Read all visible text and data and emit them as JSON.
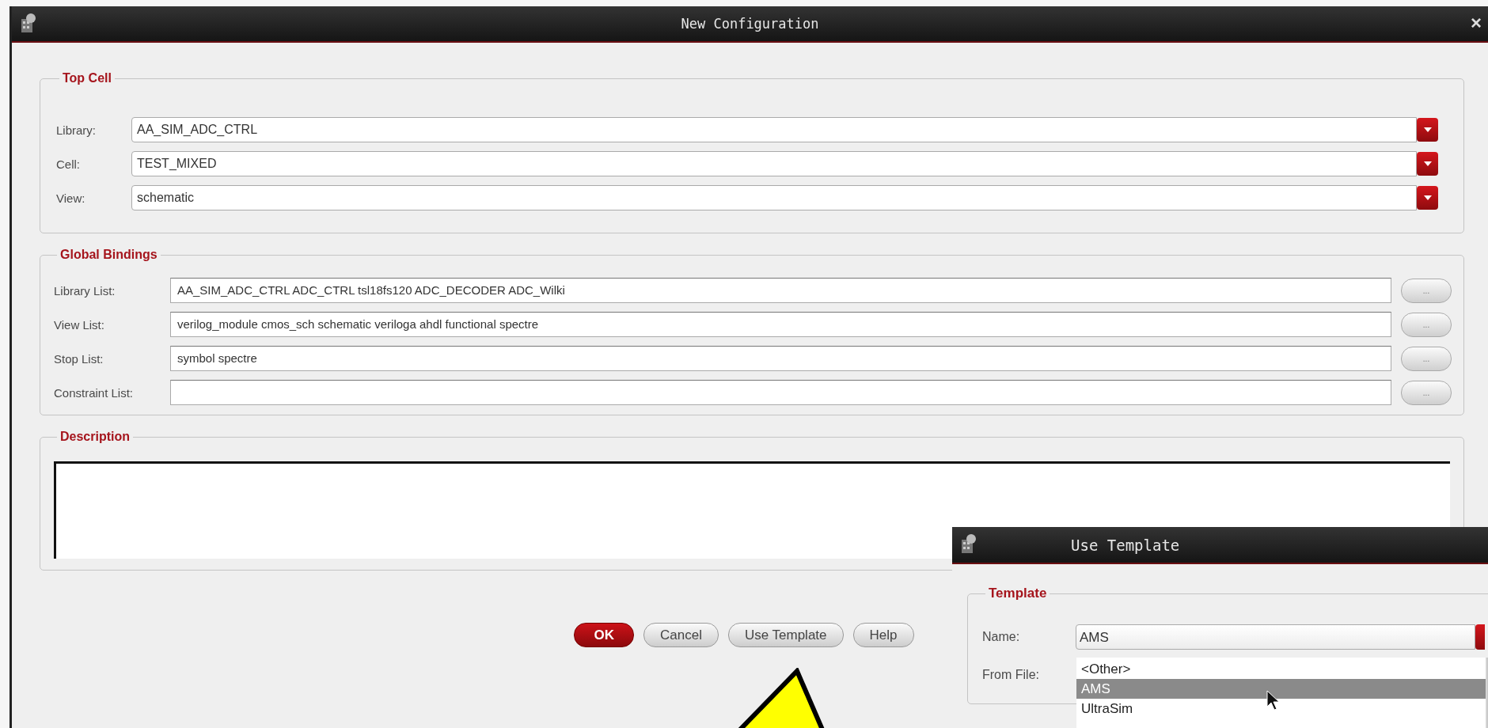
{
  "window": {
    "title": "New Configuration",
    "close": "×"
  },
  "top_cell": {
    "title": "Top Cell",
    "fields": [
      {
        "label": "Library:",
        "value": "AA_SIM_ADC_CTRL"
      },
      {
        "label": "Cell:",
        "value": "TEST_MIXED"
      },
      {
        "label": "View:",
        "value": "schematic"
      }
    ]
  },
  "global_bindings": {
    "title": "Global Bindings",
    "rows": [
      {
        "label": "Library List:",
        "value": "AA_SIM_ADC_CTRL ADC_CTRL tsl18fs120 ADC_DECODER ADC_Wilki",
        "button": "..."
      },
      {
        "label": "View List:",
        "value": "verilog_module cmos_sch schematic veriloga ahdl functional spectre",
        "button": "..."
      },
      {
        "label": "Stop List:",
        "value": "symbol spectre",
        "button": "..."
      },
      {
        "label": "Constraint List:",
        "value": "",
        "button": "..."
      }
    ]
  },
  "description": {
    "title": "Description"
  },
  "buttons": [
    {
      "label": "OK",
      "kind": "primary"
    },
    {
      "label": "Cancel",
      "kind": "normal"
    },
    {
      "label": "Use Template",
      "kind": "normal"
    },
    {
      "label": "Help",
      "kind": "normal"
    }
  ],
  "template_dialog": {
    "title": "Use Template",
    "group_title": "Template",
    "name_label": "Name:",
    "name_value": "AMS",
    "from_file_label": "From File:",
    "dropdown_items": [
      {
        "label": "<Other>",
        "selected": false
      },
      {
        "label": "AMS",
        "selected": true
      },
      {
        "label": "UltraSim",
        "selected": false
      }
    ]
  }
}
